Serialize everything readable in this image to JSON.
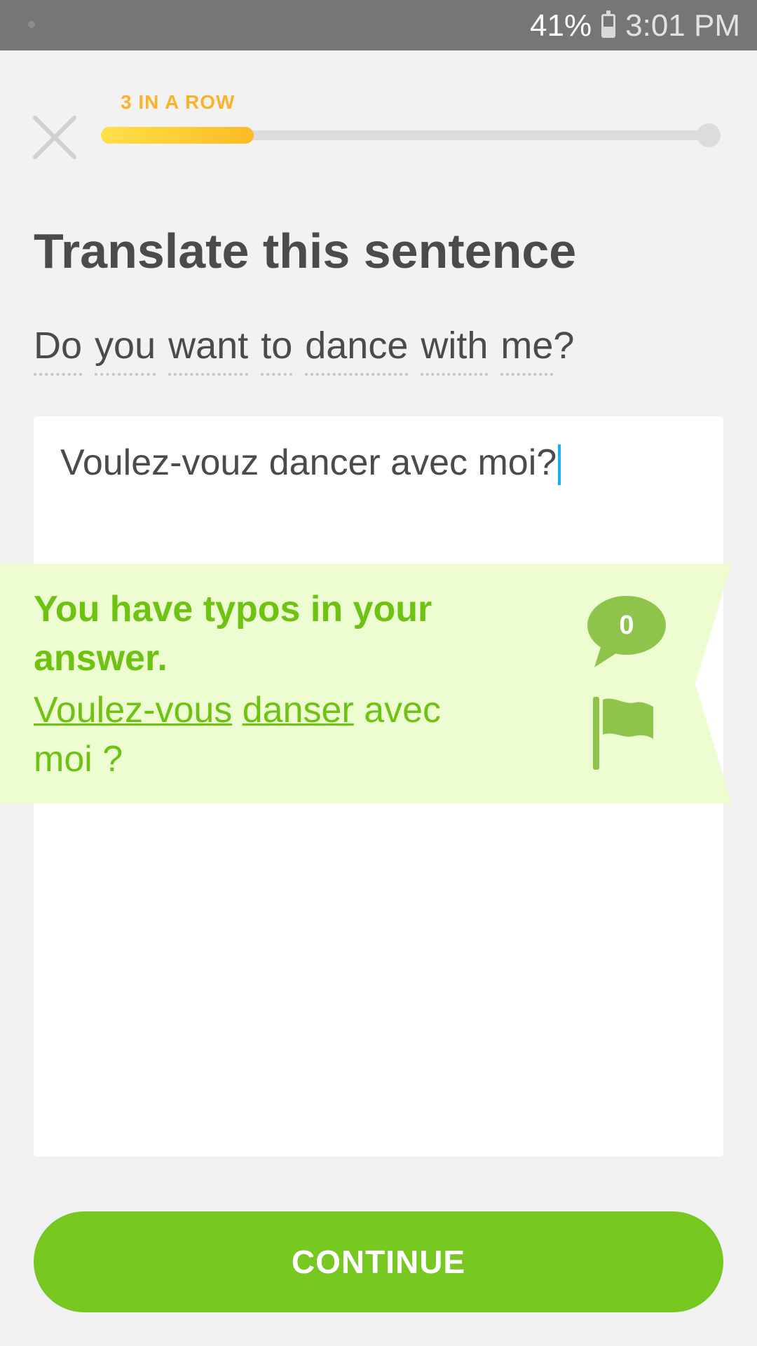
{
  "status_bar": {
    "battery": "41%",
    "time": "3:01 PM",
    "icons": [
      "notification-dot-icon",
      "battery-icon"
    ]
  },
  "lesson": {
    "streak_label": "3 IN A ROW",
    "progress": 0.25,
    "close_icon": "close-icon"
  },
  "prompt": {
    "title": "Translate this sentence",
    "words": [
      "Do",
      "you",
      "want",
      "to",
      "dance",
      "with",
      "me"
    ],
    "end_punct": "?"
  },
  "answer": {
    "value": "Voulez-vouz dancer avec moi?"
  },
  "feedback": {
    "heading": "You have typos in your answer.",
    "correction": {
      "part1": "Voulez-vous",
      "part2": "danser",
      "part3": "avec moi ?"
    },
    "comment_count": "0",
    "comment_icon": "speech-bubble-icon",
    "flag_icon": "flag-icon"
  },
  "actions": {
    "continue_label": "CONTINUE"
  },
  "colors": {
    "accent_green": "#78c822",
    "feedback_bg": "#eefcd2",
    "feedback_text": "#6ec212",
    "streak_gold": "#f7b32b",
    "caret_blue": "#1cb0f6"
  }
}
